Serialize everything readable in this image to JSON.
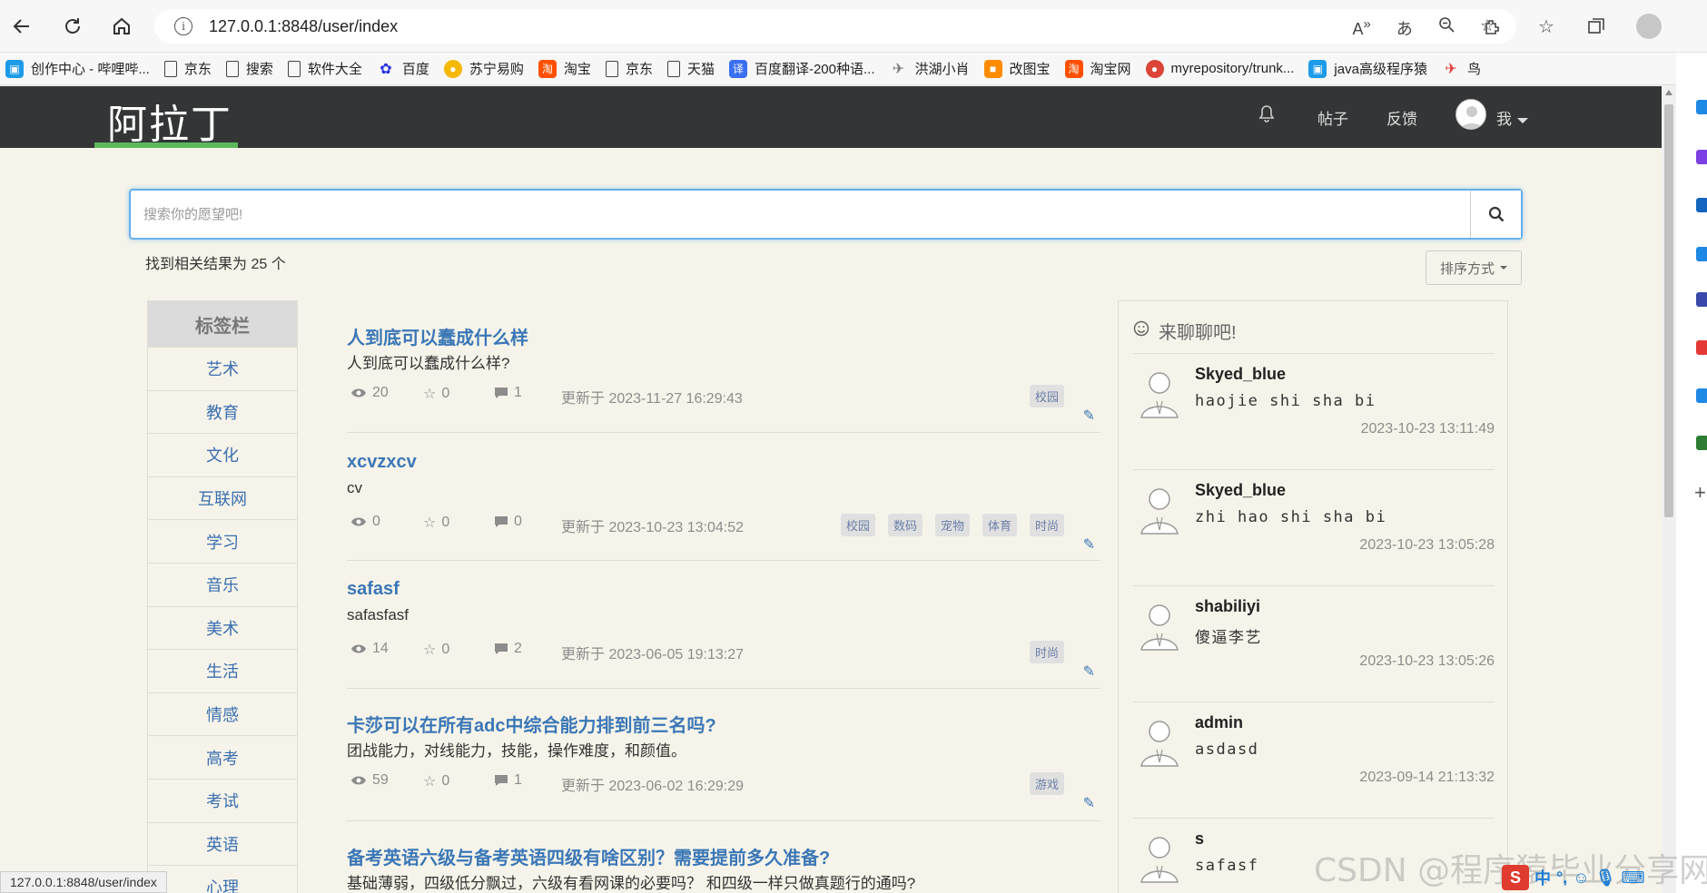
{
  "browser": {
    "url": "127.0.0.1:8848/user/index",
    "bookmarks": [
      {
        "label": "创作中心 - 哔哩哔...",
        "icon": "bilibili-icon",
        "color": "#1e9be8"
      },
      {
        "label": "京东",
        "icon": "page-icon",
        "color": ""
      },
      {
        "label": "搜索",
        "icon": "page-icon",
        "color": ""
      },
      {
        "label": "软件大全",
        "icon": "page-icon",
        "color": ""
      },
      {
        "label": "百度",
        "icon": "baidu-paw-icon",
        "color": "#2932e1"
      },
      {
        "label": "苏宁易购",
        "icon": "suning-icon",
        "color": "#f6b800"
      },
      {
        "label": "淘宝",
        "icon": "taobao-icon",
        "color": "#ff5000"
      },
      {
        "label": "京东",
        "icon": "page-icon",
        "color": ""
      },
      {
        "label": "天猫",
        "icon": "page-icon",
        "color": ""
      },
      {
        "label": "百度翻译-200种语...",
        "icon": "translate-icon",
        "color": "#3a6ff2"
      },
      {
        "label": "洪湖小肖",
        "icon": "bird-icon",
        "color": "#777777"
      },
      {
        "label": "改图宝",
        "icon": "gaitubao-icon",
        "color": "#ff8c00"
      },
      {
        "label": "淘宝网",
        "icon": "taobao-icon",
        "color": "#ff5000"
      },
      {
        "label": "myrepository/trunk...",
        "icon": "chrome-icon",
        "color": "#db4437"
      },
      {
        "label": "java高级程序猿",
        "icon": "bilibili-icon",
        "color": "#1e9be8"
      },
      {
        "label": "鸟",
        "icon": "bird-icon",
        "color": "#e53935"
      }
    ],
    "status_url": "127.0.0.1:8848/user/index"
  },
  "site": {
    "logo": "阿拉丁",
    "nav": {
      "posts": "帖子",
      "feedback": "反馈",
      "me": "我"
    }
  },
  "search": {
    "placeholder": "搜索你的愿望吧!",
    "value": "",
    "result_text": "找到相关结果为 25 个",
    "sort_label": "排序方式"
  },
  "tag_panel": {
    "title": "标签栏",
    "items": [
      "艺术",
      "教育",
      "文化",
      "互联网",
      "学习",
      "音乐",
      "美术",
      "生活",
      "情感",
      "高考",
      "考试",
      "英语",
      "心理"
    ]
  },
  "posts": [
    {
      "title": "人到底可以蠢成什么样",
      "desc": "人到底可以蠢成什么样?",
      "views": "20",
      "stars": "0",
      "comments": "1",
      "updated": "更新于 2023-11-27 16:29:43",
      "tags": [
        "校园"
      ]
    },
    {
      "title": "xcvzxcv",
      "desc": "cv",
      "views": "0",
      "stars": "0",
      "comments": "0",
      "updated": "更新于 2023-10-23 13:04:52",
      "tags": [
        "校园",
        "数码",
        "宠物",
        "体育",
        "时尚"
      ]
    },
    {
      "title": "safasf",
      "desc": "safasfasf",
      "views": "14",
      "stars": "0",
      "comments": "2",
      "updated": "更新于 2023-06-05 19:13:27",
      "tags": [
        "时尚"
      ]
    },
    {
      "title": "卡莎可以在所有adc中综合能力排到前三名吗?",
      "desc": "团战能力，对线能力，技能，操作难度，和颜值。",
      "views": "59",
      "stars": "0",
      "comments": "1",
      "updated": "更新于 2023-06-02 16:29:29",
      "tags": [
        "游戏"
      ]
    },
    {
      "title": "备考英语六级与备考英语四级有啥区别？需要提前多久准备?",
      "desc": "基础薄弱，四级低分飘过，六级有看网课的必要吗？ 和四级一样只做真题行的通吗?",
      "views": "",
      "stars": "",
      "comments": "",
      "updated": "",
      "tags": []
    }
  ],
  "chat": {
    "title": "来聊聊吧!",
    "messages": [
      {
        "name": "Skyed_blue",
        "text": "haojie shi sha bi",
        "time": "2023-10-23 13:11:49"
      },
      {
        "name": "Skyed_blue",
        "text": "zhi hao shi sha bi",
        "time": "2023-10-23 13:05:28"
      },
      {
        "name": "shabiliyi",
        "text": "傻逼李艺",
        "time": "2023-10-23 13:05:26"
      },
      {
        "name": "admin",
        "text": "asdasd",
        "time": "2023-09-14 21:13:32"
      },
      {
        "name": "s",
        "text": "safasf",
        "time": ""
      }
    ]
  },
  "watermark": "CSDN @程序猿毕业分享网",
  "ime": {
    "lang": "中"
  },
  "colors": {
    "accent": "#3b77b6",
    "navbar": "#333536",
    "background": "#f6f4ea",
    "logo_underline": "#5cb85c",
    "search_focus": "#66afe9"
  }
}
